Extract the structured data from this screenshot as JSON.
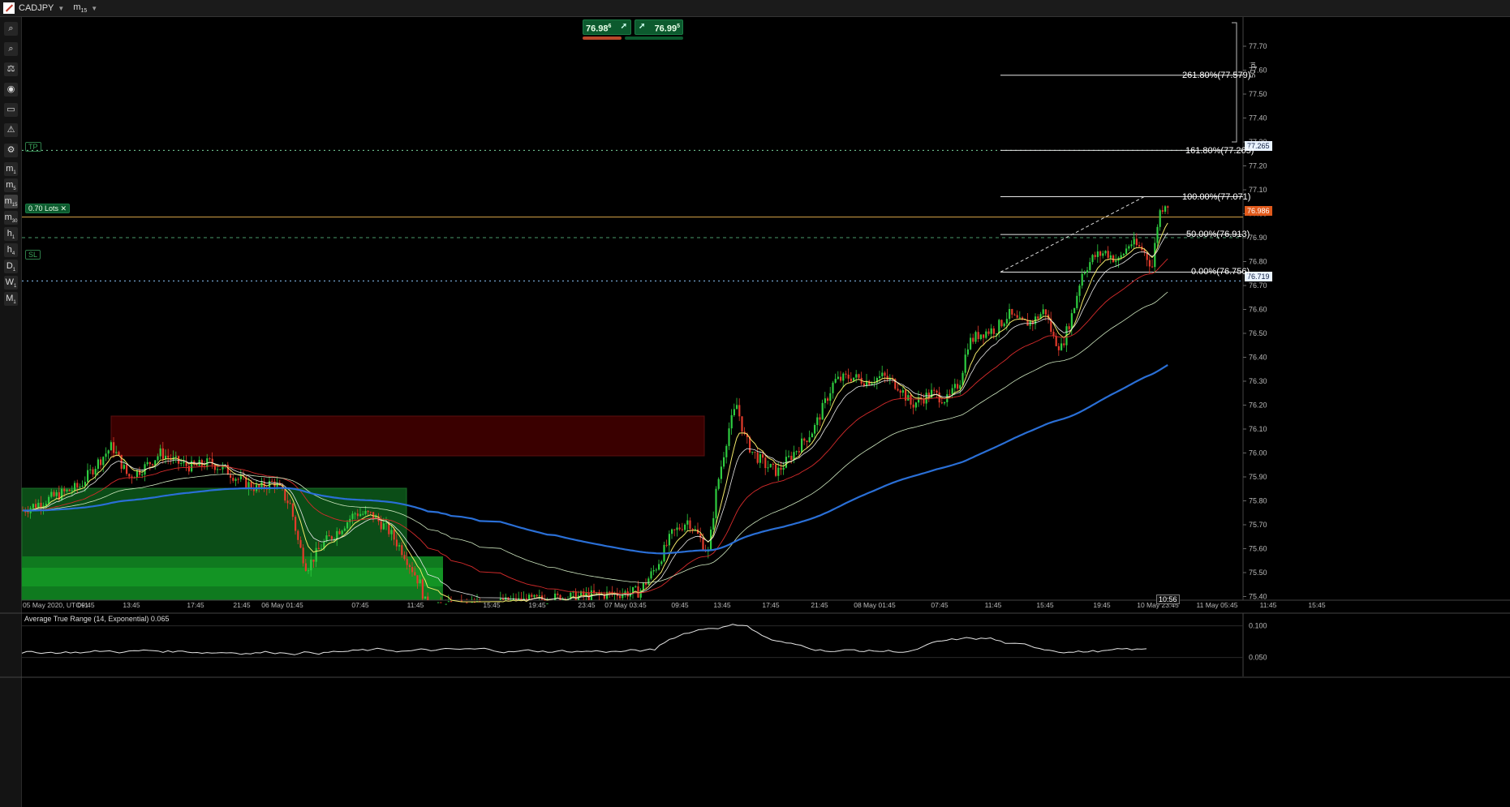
{
  "symbol": "CADJPY",
  "timeframe": "m15",
  "toolbar": {
    "timeframes": [
      {
        "label": "m",
        "sub": "1"
      },
      {
        "label": "m",
        "sub": "5"
      },
      {
        "label": "m",
        "sub": "15"
      },
      {
        "label": "m",
        "sub": "30"
      },
      {
        "label": "h",
        "sub": "1"
      },
      {
        "label": "h",
        "sub": "4"
      },
      {
        "label": "D",
        "sub": "1"
      },
      {
        "label": "W",
        "sub": "1"
      },
      {
        "label": "M",
        "sub": "1"
      }
    ],
    "active_timeframe": "m15",
    "tools": [
      "zoom-in-icon",
      "zoom-out-icon",
      "indicator-icon",
      "sentiment-icon",
      "display-icon",
      "robot-icon",
      "settings-icon"
    ]
  },
  "trade_panel": {
    "sell_price": "76.98",
    "sell_super": "6",
    "buy_price": "76.99",
    "buy_super": "5"
  },
  "price_axis": {
    "ticks": [
      "77.70",
      "77.60",
      "77.50",
      "77.40",
      "77.30",
      "77.20",
      "77.10",
      "77.00",
      "76.90",
      "76.80",
      "76.70",
      "76.60",
      "76.50",
      "76.40",
      "76.30",
      "76.20",
      "76.10",
      "76.00",
      "75.90",
      "75.80",
      "75.70",
      "75.60",
      "75.50",
      "75.40"
    ],
    "current_price": "76.986",
    "tp_price": "77.265",
    "sl_price": "76.719"
  },
  "time_axis": {
    "labels": [
      "05 May 2020, UTC+1",
      "09:45",
      "13:45",
      "17:45",
      "21:45",
      "06 May 01:45",
      "07:45",
      "11:45",
      "15:45",
      "19:45",
      "23:45",
      "07 May 03:45",
      "09:45",
      "13:45",
      "17:45",
      "21:45",
      "08 May 01:45",
      "07:45",
      "11:45",
      "15:45",
      "19:45",
      "10 May 23:45",
      "11 May 05:45",
      "11:45",
      "15:45"
    ],
    "current_time": "10:56"
  },
  "fibonacci": [
    {
      "label": "261.80%(77.579)",
      "price": 77.579
    },
    {
      "label": "161.80%(77.265)",
      "price": 77.265
    },
    {
      "label": "100.00%(77.071)",
      "price": 77.071
    },
    {
      "label": "50.00%(76.913)",
      "price": 76.913
    },
    {
      "label": "0.00%(76.756)",
      "price": 76.756
    }
  ],
  "position_lines": {
    "tp_label": "TP",
    "lots_label": "0.70 Lots",
    "sl_label": "SL"
  },
  "pips_label": "50 pi",
  "indicator": {
    "title": "Average True Range (14, Exponential) 0.065",
    "ticks": [
      "0.100",
      "0.050"
    ]
  },
  "chart_data": {
    "type": "candlestick",
    "symbol": "CADJPY",
    "ylim": [
      75.36,
      77.78
    ],
    "close_path": [
      [
        0,
        75.76
      ],
      [
        40,
        75.82
      ],
      [
        70,
        75.86
      ],
      [
        90,
        75.95
      ],
      [
        110,
        76.03
      ],
      [
        130,
        75.9
      ],
      [
        150,
        75.94
      ],
      [
        170,
        76.0
      ],
      [
        190,
        75.96
      ],
      [
        210,
        75.94
      ],
      [
        230,
        75.96
      ],
      [
        250,
        75.93
      ],
      [
        270,
        75.88
      ],
      [
        290,
        75.85
      ],
      [
        310,
        75.88
      ],
      [
        330,
        75.78
      ],
      [
        340,
        75.62
      ],
      [
        350,
        75.52
      ],
      [
        370,
        75.62
      ],
      [
        390,
        75.68
      ],
      [
        410,
        75.75
      ],
      [
        430,
        75.74
      ],
      [
        450,
        75.68
      ],
      [
        470,
        75.58
      ],
      [
        490,
        75.45
      ],
      [
        498,
        75.35
      ],
      [
        760,
        75.42
      ],
      [
        780,
        75.52
      ],
      [
        800,
        75.66
      ],
      [
        820,
        75.72
      ],
      [
        835,
        75.64
      ],
      [
        845,
        75.58
      ],
      [
        855,
        75.85
      ],
      [
        870,
        76.1
      ],
      [
        880,
        76.2
      ],
      [
        890,
        76.06
      ],
      [
        900,
        76.0
      ],
      [
        915,
        75.95
      ],
      [
        930,
        75.92
      ],
      [
        945,
        75.98
      ],
      [
        960,
        76.04
      ],
      [
        975,
        76.1
      ],
      [
        990,
        76.22
      ],
      [
        1000,
        76.3
      ],
      [
        1020,
        76.32
      ],
      [
        1040,
        76.3
      ],
      [
        1060,
        76.32
      ],
      [
        1080,
        76.28
      ],
      [
        1095,
        76.2
      ],
      [
        1105,
        76.22
      ],
      [
        1120,
        76.25
      ],
      [
        1140,
        76.22
      ],
      [
        1155,
        76.3
      ],
      [
        1165,
        76.46
      ],
      [
        1180,
        76.5
      ],
      [
        1200,
        76.52
      ],
      [
        1215,
        76.58
      ],
      [
        1230,
        76.54
      ],
      [
        1245,
        76.55
      ],
      [
        1260,
        76.6
      ],
      [
        1270,
        76.48
      ],
      [
        1280,
        76.44
      ],
      [
        1295,
        76.6
      ],
      [
        1305,
        76.75
      ],
      [
        1320,
        76.82
      ],
      [
        1335,
        76.84
      ],
      [
        1350,
        76.8
      ],
      [
        1365,
        76.88
      ],
      [
        1380,
        76.85
      ],
      [
        1392,
        76.78
      ],
      [
        1400,
        77.0
      ],
      [
        1410,
        77.06
      ],
      [
        1414,
        76.99
      ]
    ],
    "atr_ticks": [
      0.1,
      0.05
    ],
    "atr_current": 0.065
  },
  "colors": {
    "bull": "#2ecc40",
    "bear": "#e23b2b",
    "ma200": "#2a6fd6",
    "ma_red": "#d62b2b",
    "ma_white": "#e8e8e8",
    "ma_yellow": "#f2e96a",
    "current_price": "#e05a1c"
  }
}
